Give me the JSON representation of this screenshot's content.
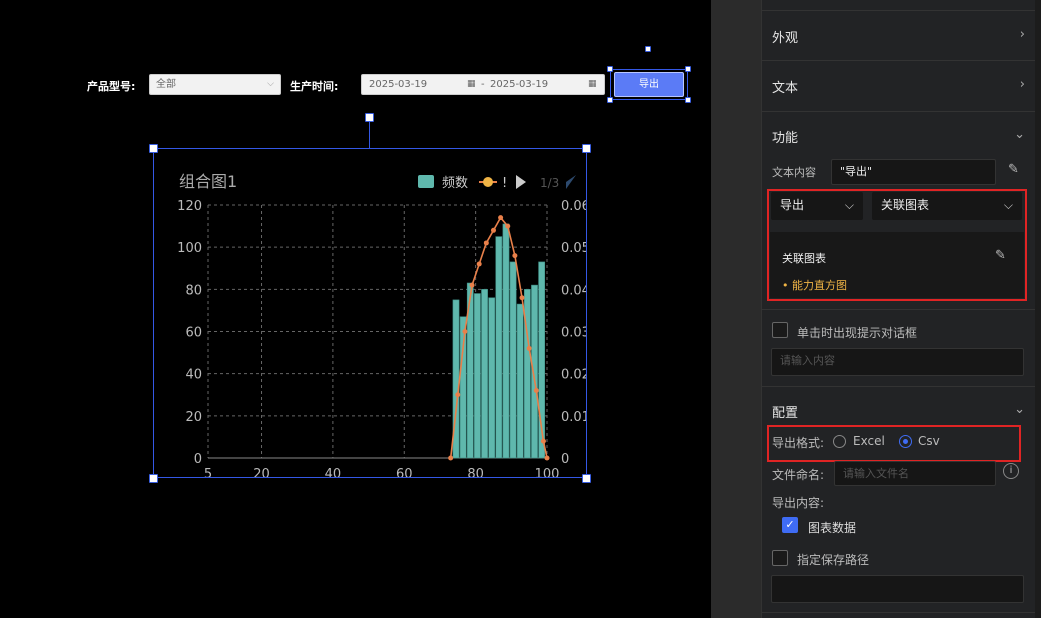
{
  "filter": {
    "product_label": "产品型号:",
    "product_value": "全部",
    "time_label": "生产时间:",
    "date_start": "2025-03-19",
    "date_sep": "-",
    "date_end": "2025-03-19",
    "export_label": "导出"
  },
  "chart_data": {
    "type": "bar",
    "title": "组合图1",
    "legend": {
      "items": [
        "频数",
        "!"
      ],
      "page": "1/3",
      "position": "top-right"
    },
    "x_ticks": [
      "5",
      "20",
      "40",
      "60",
      "80",
      "100"
    ],
    "y_left_ticks": [
      "0",
      "20",
      "40",
      "60",
      "80",
      "100",
      "120"
    ],
    "y_right_ticks": [
      "0",
      "0.01",
      "0.02",
      "0.03",
      "0.04",
      "0.05",
      "0.06"
    ],
    "ylim_left": [
      0,
      120
    ],
    "ylim_right": [
      0,
      0.06
    ],
    "xlim": [
      5,
      100
    ],
    "grid": true,
    "colors": {
      "bars": "#5fb8ad",
      "line": "#e9804a",
      "axis": "#888888",
      "grid": "#666666"
    },
    "series": [
      {
        "name": "频数",
        "type": "bar",
        "x": [
          74.5,
          76.5,
          78.5,
          80.5,
          82.5,
          84.5,
          86.5,
          88.5,
          90.5,
          92.5,
          94.5,
          96.5,
          98.5
        ],
        "values": [
          75,
          67,
          83,
          78,
          80,
          76,
          105,
          111,
          93,
          73,
          80,
          82,
          93
        ]
      },
      {
        "name": "!",
        "type": "line",
        "axis": "right",
        "x": [
          73,
          75,
          77,
          79,
          81,
          83,
          85,
          87,
          89,
          91,
          93,
          95,
          97,
          99,
          100
        ],
        "values": [
          0,
          0.015,
          0.03,
          0.041,
          0.046,
          0.051,
          0.054,
          0.057,
          0.055,
          0.048,
          0.038,
          0.026,
          0.016,
          0.004,
          0
        ]
      }
    ]
  },
  "panel": {
    "appearance": "外观",
    "text_section": "文本",
    "function_section": "功能",
    "text_content_label": "文本内容",
    "text_content_value": "\"导出\"",
    "action_value": "导出",
    "linked_chart_select": "关联图表",
    "linked_chart_title": "关联图表",
    "linked_chart_item": "能力直方图",
    "confirm_label": "单击时出现提示对话框",
    "confirm_placeholder": "请输入内容",
    "config_section": "配置",
    "export_format_label": "导出格式:",
    "format_excel": "Excel",
    "format_csv": "Csv",
    "file_name_label": "文件命名:",
    "file_name_placeholder": "请输入文件名",
    "export_content_label": "导出内容:",
    "chart_data_label": "图表数据",
    "save_path_label": "指定保存路径",
    "accent": "#3f6cf5",
    "highlight": "#e02424",
    "item_color": "#f0b445"
  }
}
